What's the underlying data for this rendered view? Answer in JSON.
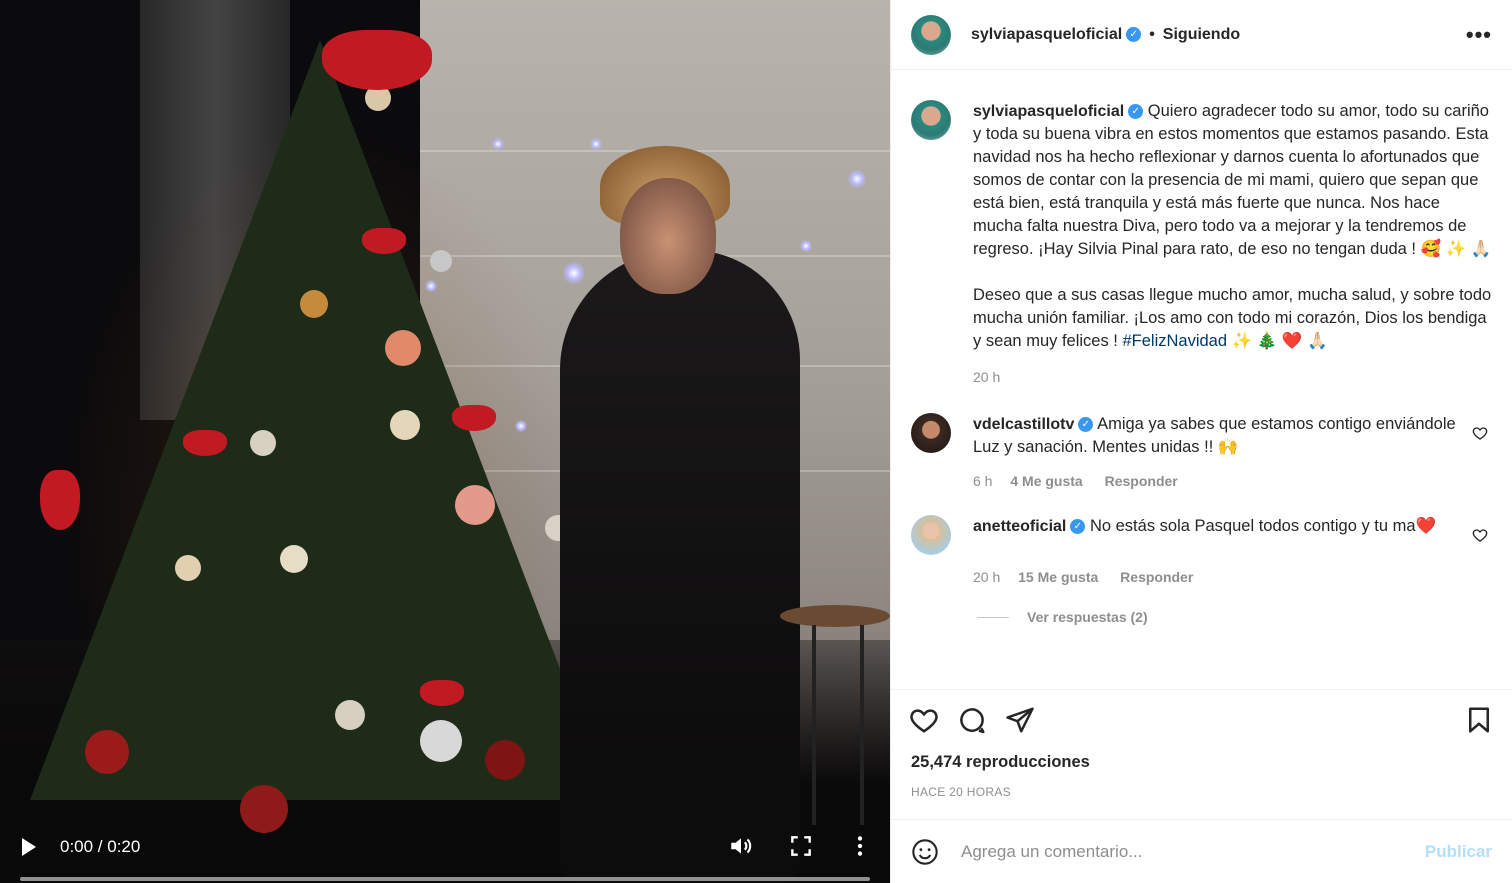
{
  "colors": {
    "accent": "#0095f6",
    "verified": "#3897f0",
    "hashtag": "#00376b",
    "muted": "#8e8e8e"
  },
  "video": {
    "time": "0:00 / 0:20",
    "progress": 0,
    "icons": {
      "play": "play-icon",
      "volume": "volume-icon",
      "fullscreen": "fullscreen-icon",
      "more": "more-vertical-icon"
    }
  },
  "header": {
    "username": "sylviapasqueloficial",
    "separator": "•",
    "follow_label": "Siguiendo",
    "more_label": "•••"
  },
  "post": {
    "username": "sylviapasqueloficial",
    "caption_p1": "Quiero agradecer todo su amor, todo su cariño y toda su buena vibra en estos momentos que estamos pasando. Esta navidad nos ha hecho reflexionar y darnos cuenta lo afortunados que somos de contar con la presencia de mi mami, quiero que sepan que está bien, está tranquila y está más fuerte que nunca. Nos hace mucha falta nuestra Diva, pero todo va a mejorar y la tendremos de regreso. ¡Hay Silvia Pinal para rato, de eso no tengan duda ! 🥰 ✨ 🙏🏻",
    "caption_p2": "Deseo que a sus casas llegue mucho amor, mucha salud, y sobre todo mucha unión familiar. ¡Los amo con todo mi corazón, Dios los bendiga y sean muy felices ! ",
    "hashtag": "#FelizNavidad",
    "caption_p2_end": " ✨ 🎄 ❤️ 🙏🏻",
    "time": "20 h"
  },
  "comments": [
    {
      "username": "vdelcastillotv",
      "text": "Amiga ya sabes que estamos contigo enviándole Luz y sanación. Mentes unidas !! 🙌",
      "time": "6 h",
      "likes": "4 Me gusta",
      "reply_label": "Responder"
    },
    {
      "username": "anetteoficial",
      "text": "No estás sola Pasquel todos contigo y tu ma❤️",
      "time": "20 h",
      "likes": "15 Me gusta",
      "reply_label": "Responder",
      "view_replies": "Ver respuestas (2)"
    }
  ],
  "stats": {
    "views": "25,474 reproducciones",
    "ago": "HACE 20 HORAS"
  },
  "add_comment": {
    "placeholder": "Agrega un comentario...",
    "publish_label": "Publicar"
  }
}
